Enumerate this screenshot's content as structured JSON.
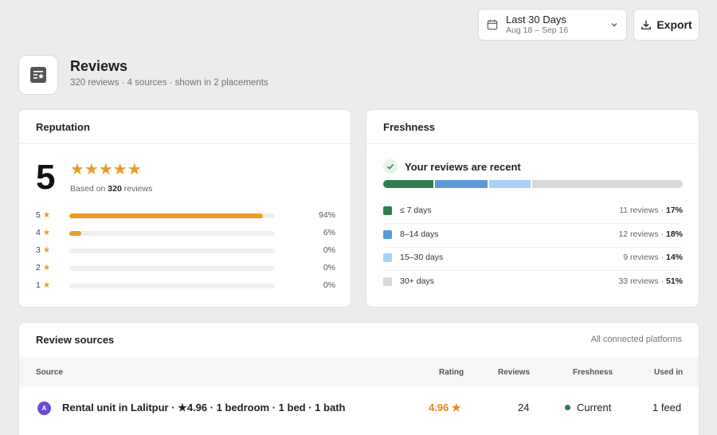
{
  "date_range": {
    "label": "Last 30 Days",
    "range": "Aug 18 – Sep 16"
  },
  "export_label": "Export",
  "page": {
    "title": "Reviews",
    "subtitle": "320 reviews · 4 sources · shown in 2 placements"
  },
  "reputation": {
    "title": "Reputation",
    "score": "5",
    "stars": "★★★★★",
    "based_prefix": "Based on",
    "based_count": "320",
    "based_suffix": "reviews",
    "rows": [
      {
        "label": "5",
        "star": "★",
        "pct": "94%",
        "fraction": 0.94
      },
      {
        "label": "4",
        "star": "★",
        "pct": "6%",
        "fraction": 0.06
      },
      {
        "label": "3",
        "star": "★",
        "pct": "0%",
        "fraction": 0
      },
      {
        "label": "2",
        "star": "★",
        "pct": "0%",
        "fraction": 0
      },
      {
        "label": "1",
        "star": "★",
        "pct": "0%",
        "fraction": 0
      }
    ]
  },
  "freshness": {
    "title": "Freshness",
    "status": "Your reviews are recent",
    "rows": [
      {
        "label": "≤ 7 days",
        "count": "11 reviews",
        "pct": "17%",
        "fraction": 0.17,
        "color": "#2e7d4f"
      },
      {
        "label": "8–14 days",
        "count": "12 reviews",
        "pct": "18%",
        "fraction": 0.18,
        "color": "#5b9bd5"
      },
      {
        "label": "15–30 days",
        "count": "9 reviews",
        "pct": "14%",
        "fraction": 0.14,
        "color": "#a9d1f5"
      },
      {
        "label": "30+ days",
        "count": "33 reviews",
        "pct": "51%",
        "fraction": 0.51,
        "color": "#d6d8dc"
      }
    ]
  },
  "sources": {
    "title": "Review sources",
    "hint": "All connected platforms",
    "columns": {
      "source": "Source",
      "rating": "Rating",
      "reviews": "Reviews",
      "freshness": "Freshness",
      "used_in": "Used in"
    },
    "rows": [
      {
        "avatar": "A",
        "name": "Rental unit in Lalitpur · ★4.96 · 1 bedroom · 1 bed · 1 bath",
        "rating": "4.96 ★",
        "reviews": "24",
        "freshness": "Current",
        "used_in": "1 feed"
      }
    ]
  }
}
